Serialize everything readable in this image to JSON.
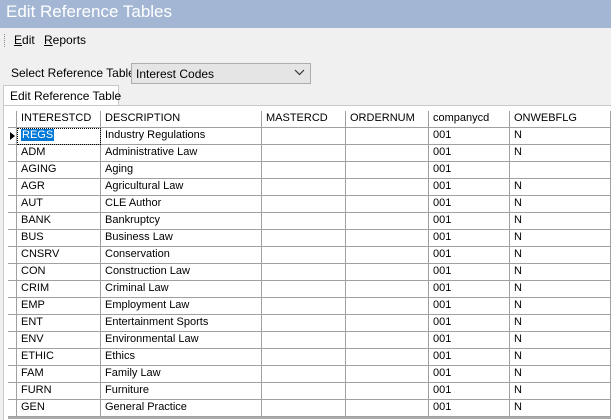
{
  "window": {
    "title": "Edit Reference Tables"
  },
  "menu": {
    "edit_label": "Edit",
    "reports_label": "Reports"
  },
  "selector": {
    "label": "Select Reference Table:",
    "selected": "Interest Codes"
  },
  "tab": {
    "label": "Edit Reference Table"
  },
  "grid": {
    "columns": [
      "INTERESTCD",
      "DESCRIPTION",
      "MASTERCD",
      "ORDERNUM",
      "companycd",
      "ONWEBFLG"
    ],
    "current_row": 0,
    "rows": [
      [
        "REGS",
        "Industry Regulations",
        "",
        "",
        "001",
        "N"
      ],
      [
        "ADM",
        "Administrative Law",
        "",
        "",
        "001",
        "N"
      ],
      [
        "AGING",
        "Aging",
        "",
        "",
        "001",
        ""
      ],
      [
        "AGR",
        "Agricultural Law",
        "",
        "",
        "001",
        "N"
      ],
      [
        "AUT",
        "CLE Author",
        "",
        "",
        "001",
        "N"
      ],
      [
        "BANK",
        "Bankruptcy",
        "",
        "",
        "001",
        "N"
      ],
      [
        "BUS",
        "Business Law",
        "",
        "",
        "001",
        "N"
      ],
      [
        "CNSRV",
        "Conservation",
        "",
        "",
        "001",
        "N"
      ],
      [
        "CON",
        "Construction Law",
        "",
        "",
        "001",
        "N"
      ],
      [
        "CRIM",
        "Criminal Law",
        "",
        "",
        "001",
        "N"
      ],
      [
        "EMP",
        "Employment Law",
        "",
        "",
        "001",
        "N"
      ],
      [
        "ENT",
        "Entertainment Sports",
        "",
        "",
        "001",
        "N"
      ],
      [
        "ENV",
        "Environmental Law",
        "",
        "",
        "001",
        "N"
      ],
      [
        "ETHIC",
        "Ethics",
        "",
        "",
        "001",
        "N"
      ],
      [
        "FAM",
        "Family Law",
        "",
        "",
        "001",
        "N"
      ],
      [
        "FURN",
        "Furniture",
        "",
        "",
        "001",
        "N"
      ],
      [
        "GEN",
        "General Practice",
        "",
        "",
        "001",
        "N"
      ]
    ]
  }
}
